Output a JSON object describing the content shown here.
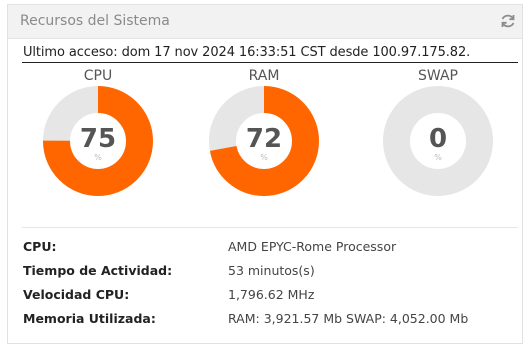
{
  "panel": {
    "title": "Recursos del Sistema",
    "refresh_icon": "refresh-icon"
  },
  "last_access": "Ultimo acceso: dom 17 nov 2024 16:33:51 CST desde 100.97.175.82.",
  "gauges": [
    {
      "label": "CPU",
      "value": "75",
      "unit": "%",
      "percent": 75,
      "color": "#ff6600",
      "track": "#e6e6e6"
    },
    {
      "label": "RAM",
      "value": "72",
      "unit": "%",
      "percent": 72,
      "color": "#ff6600",
      "track": "#e6e6e6"
    },
    {
      "label": "SWAP",
      "value": "0",
      "unit": "%",
      "percent": 0,
      "color": "#ff6600",
      "track": "#e6e6e6"
    }
  ],
  "info": [
    {
      "key": "CPU:",
      "value": "AMD EPYC-Rome Processor"
    },
    {
      "key": "Tiempo de Actividad:",
      "value": "53 minutos(s)"
    },
    {
      "key": "Velocidad CPU:",
      "value": "1,796.62 MHz"
    },
    {
      "key": "Memoria Utilizada:",
      "value": "RAM: 3,921.57 Mb SWAP: 4,052.00 Mb"
    }
  ]
}
